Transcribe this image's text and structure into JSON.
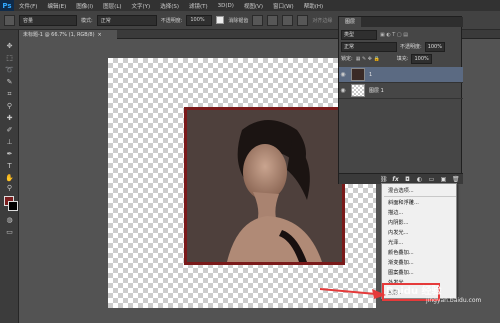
{
  "app": {
    "logo": "Ps"
  },
  "menubar": {
    "items": [
      "文件(F)",
      "编辑(E)",
      "图像(I)",
      "图层(L)",
      "文字(Y)",
      "选择(S)",
      "滤镜(T)",
      "3D(D)",
      "视图(V)",
      "窗口(W)",
      "帮助(H)"
    ]
  },
  "options": {
    "blend_value": "容量",
    "mode_label": "模式:",
    "mode_value": "正常",
    "opacity_label": "不透明度:",
    "opacity_value": "100%",
    "smooth_label": "消除锯齿",
    "align_edges_label": "对齐边缘"
  },
  "document": {
    "tab_title": "未标题-1 @ 66.7% (1, RGB/8)",
    "tab_close": "×"
  },
  "layers_panel": {
    "tab_label": "图层",
    "filter_kind": "类型",
    "blend_mode": "正常",
    "opacity_label": "不透明度:",
    "opacity_value": "100%",
    "lock_label": "锁定:",
    "fill_label": "填充:",
    "fill_value": "100%",
    "layers": [
      {
        "name": "1",
        "selected": true
      },
      {
        "name": "图层 1",
        "selected": false
      }
    ]
  },
  "fx_menu": {
    "items": [
      "混合选项...",
      "斜面和浮雕...",
      "描边...",
      "内阴影...",
      "内发光...",
      "光泽...",
      "颜色叠加...",
      "渐变叠加...",
      "图案叠加...",
      "外发光...",
      "投影..."
    ]
  },
  "watermark": {
    "brand": "Baidu 经验",
    "url": "jingyan.baidu.com"
  },
  "colors": {
    "accent_red": "#e53a3a",
    "frame_red": "#7a1a1a",
    "foreground": "#7a1f1f",
    "background": "#000000"
  }
}
